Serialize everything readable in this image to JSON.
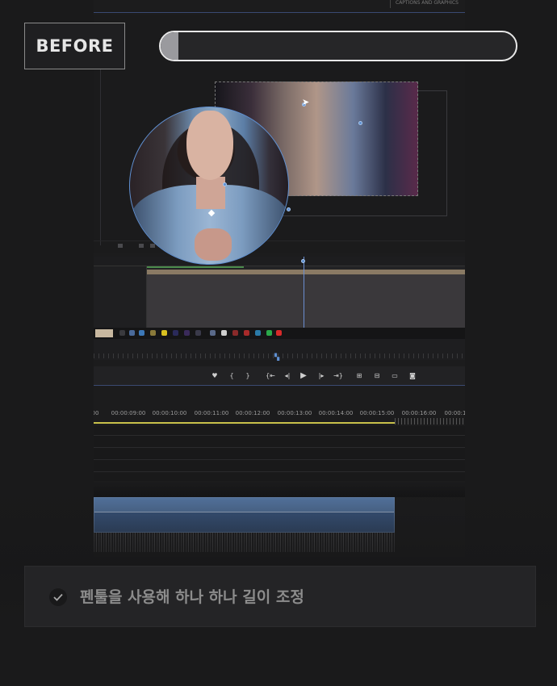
{
  "overlay": {
    "badge": "BEFORE",
    "progress": 0.05,
    "caption": "펜툴을 사용해 하나 하나 길이 조정"
  },
  "app": {
    "panel_tab": "CAPTIONS AND GRAPHICS",
    "timeline_timecodes": [
      "00",
      "00:00:09:00",
      "00:00:10:00",
      "00:00:11:00",
      "00:00:12:00",
      "00:00:13:00",
      "00:00:14:00",
      "00:00:15:00",
      "00:00:16:00",
      "00:00:1"
    ]
  },
  "icons": {
    "transport": [
      "marker-icon",
      "in-point-icon",
      "out-point-icon",
      "go-to-in-icon",
      "step-back-icon",
      "play-icon",
      "step-forward-icon",
      "go-to-out-icon",
      "insert-icon",
      "overwrite-icon",
      "export-frame-icon",
      "camera-icon"
    ],
    "check": "check-icon"
  },
  "colors": {
    "mask_path": "#5f8fd0",
    "playhead": "#6a8ed0",
    "work_area": "#c8c04a",
    "video_clip": "#5a7eae"
  }
}
